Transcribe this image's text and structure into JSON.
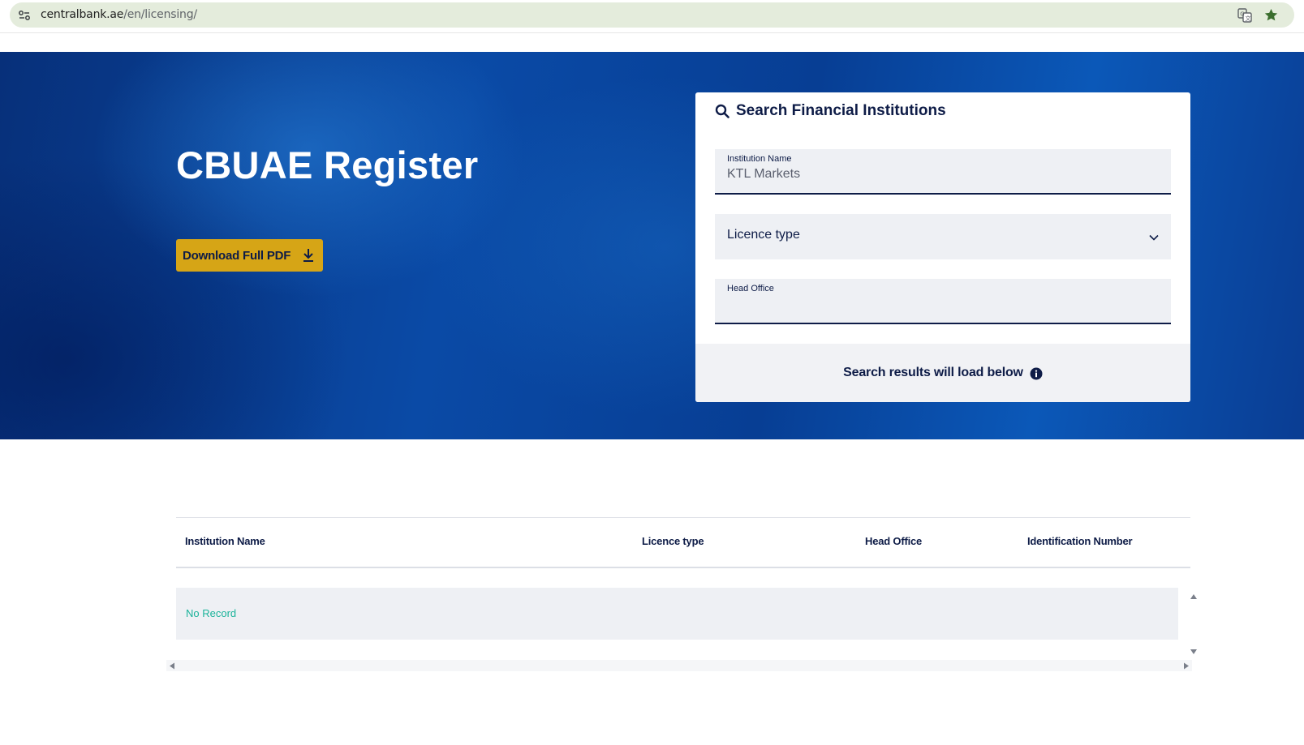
{
  "browser": {
    "url_host": "centralbank.ae",
    "url_path": "/en/licensing/",
    "icons": [
      "site-info-icon",
      "translate-icon",
      "bookmark-star-icon"
    ],
    "star_color": "#3b6e2e"
  },
  "hero": {
    "title": "CBUAE Register",
    "download_button": "Download Full PDF",
    "download_icon": "download-icon",
    "button_color": "#d6a516"
  },
  "search": {
    "title": "Search Financial Institutions",
    "institution_name_label": "Institution Name",
    "institution_name_value": "KTL Markets",
    "licence_type_placeholder": "Licence type",
    "head_office_label": "Head Office",
    "head_office_value": "",
    "results_note": "Search results will load below"
  },
  "table": {
    "columns": [
      "Institution Name",
      "Licence type",
      "Head Office",
      "Identification Number"
    ],
    "empty_text": "No Record"
  },
  "colors": {
    "navy": "#0e1c47",
    "hero_blue": "#0a4aa6",
    "no_record_teal": "#1bb39a"
  }
}
